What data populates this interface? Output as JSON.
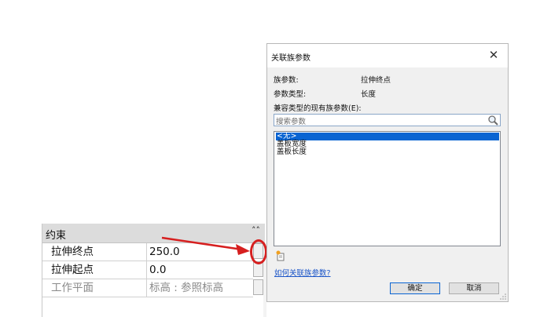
{
  "properties": {
    "section_title": "约束",
    "collapse_icon": "double-chevron-up",
    "rows": [
      {
        "name": "拉伸终点",
        "value": "250.0"
      },
      {
        "name": "拉伸起点",
        "value": "0.0"
      },
      {
        "name": "工作平面",
        "value": "标高 : 参照标高"
      }
    ]
  },
  "annotation": {
    "arrow_color": "#d61f1f"
  },
  "dialog": {
    "title": "关联族参数",
    "close_icon": "close",
    "family_param_label": "族参数:",
    "family_param_value": "拉伸终点",
    "param_type_label": "参数类型:",
    "param_type_value": "长度",
    "compatible_label": "兼容类型的现有族参数(E):",
    "search_placeholder": "搜索参数",
    "search_icon": "magnifier",
    "list_items": [
      "<无>",
      "盖板宽度",
      "盖板长度"
    ],
    "selected_index": 0,
    "new_param_icon": "new-parameter",
    "help_link": "如何关联族参数?",
    "ok_label": "确定",
    "cancel_label": "取消",
    "accent_color": "#0a64d2"
  }
}
